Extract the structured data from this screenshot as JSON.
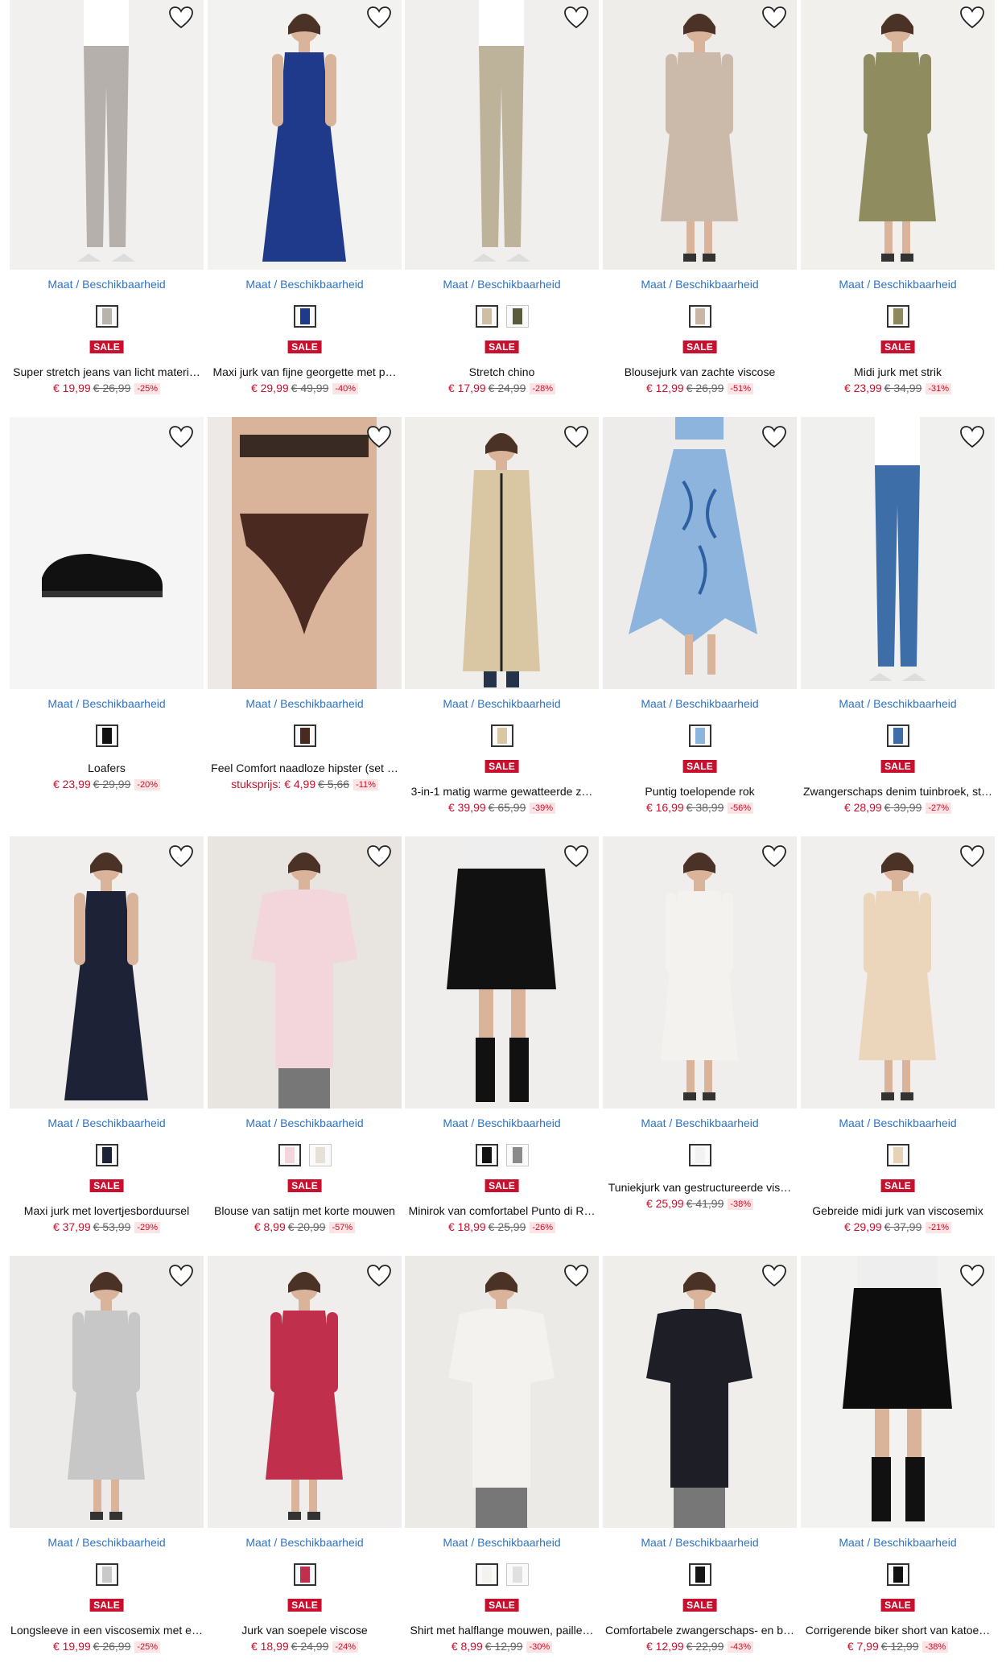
{
  "labels": {
    "maat": "Maat / Beschikbaarheid",
    "sale": "SALE"
  },
  "colors": {
    "accent": "#2f73c4",
    "sale": "#c8102e",
    "discount_bg": "#fde4e4"
  },
  "products": [
    {
      "name": "Super stretch jeans van licht materi…",
      "price": "€ 19,99",
      "old": "€ 26,99",
      "discount": "-25%",
      "sale": true,
      "swatches": [
        "#b9b3ad"
      ],
      "img": {
        "bg": "#f1f0ee",
        "type": "pants",
        "color": "#b6b0ac"
      }
    },
    {
      "name": "Maxi jurk van fijne georgette met p…",
      "price": "€ 29,99",
      "old": "€ 49,99",
      "discount": "-40%",
      "sale": true,
      "swatches": [
        "#1f3a8a"
      ],
      "img": {
        "bg": "#f2f2f0",
        "type": "dress-long",
        "color": "#1f3a8a"
      }
    },
    {
      "name": "Stretch chino",
      "price": "€ 17,99",
      "old": "€ 24,99",
      "discount": "-28%",
      "sale": true,
      "swatches": [
        "#cdbfa6",
        "#5a5a3c"
      ],
      "img": {
        "bg": "#f0efed",
        "type": "pants",
        "color": "#bdb29a"
      }
    },
    {
      "name": "Blousejurk van zachte viscose",
      "price": "€ 12,99",
      "old": "€ 26,99",
      "discount": "-51%",
      "sale": true,
      "swatches": [
        "#c8b5a6"
      ],
      "img": {
        "bg": "#eeedea",
        "type": "dress",
        "color": "#cbb9aa"
      }
    },
    {
      "name": "Midi jurk met strik",
      "price": "€ 23,99",
      "old": "€ 34,99",
      "discount": "-31%",
      "sale": true,
      "swatches": [
        "#8c8a5c"
      ],
      "img": {
        "bg": "#f1f0ed",
        "type": "dress",
        "color": "#8f8c5f"
      }
    },
    {
      "name": "Loafers",
      "price": "€ 23,99",
      "old": "€ 29,99",
      "discount": "-20%",
      "sale": false,
      "swatches": [
        "#111111"
      ],
      "img": {
        "bg": "#f5f5f5",
        "type": "shoe",
        "color": "#111111"
      }
    },
    {
      "name": "Feel Comfort naadloze hipster (set …",
      "price_label": "stuksprijs:",
      "price": "€ 4,99",
      "old": "€ 5,66",
      "discount": "-11%",
      "sale": false,
      "swatches": [
        "#4a2a20"
      ],
      "img": {
        "bg": "#ece9e6",
        "type": "brief",
        "color": "#4a2a20"
      }
    },
    {
      "name": "3-in-1 matig warme gewatteerde z…",
      "price": "€ 39,99",
      "old": "€ 65,99",
      "discount": "-39%",
      "sale": true,
      "swatches": [
        "#d9c7a4"
      ],
      "img": {
        "bg": "#efeeeb",
        "type": "coat",
        "color": "#d9c7a4"
      }
    },
    {
      "name": "Puntig toelopende rok",
      "price": "€ 16,99",
      "old": "€ 38,99",
      "discount": "-56%",
      "sale": true,
      "swatches": [
        "#8db4dc"
      ],
      "img": {
        "bg": "#eeecea",
        "type": "skirt",
        "color": "#8db4dc"
      }
    },
    {
      "name": "Zwangerschaps denim tuinbroek, st…",
      "price": "€ 28,99",
      "old": "€ 39,99",
      "discount": "-27%",
      "sale": true,
      "swatches": [
        "#3d6ea8"
      ],
      "img": {
        "bg": "#f0f0ee",
        "type": "pants",
        "color": "#3d6ea8"
      }
    },
    {
      "name": "Maxi jurk met lovertjesborduursel",
      "price": "€ 37,99",
      "old": "€ 53,99",
      "discount": "-29%",
      "sale": true,
      "swatches": [
        "#1d2236"
      ],
      "img": {
        "bg": "#f0efed",
        "type": "dress-long",
        "color": "#1d2236"
      }
    },
    {
      "name": "Blouse van satijn met korte mouwen",
      "price": "€ 8,99",
      "old": "€ 20,99",
      "discount": "-57%",
      "sale": true,
      "swatches": [
        "#f3d6dc",
        "#e5e0d8"
      ],
      "img": {
        "bg": "#e8e4e0",
        "type": "top",
        "color": "#f3d6dc"
      }
    },
    {
      "name": "Minirok van comfortabel Punto di R…",
      "price": "€ 18,99",
      "old": "€ 25,99",
      "discount": "-26%",
      "sale": true,
      "swatches": [
        "#111111",
        "#8a8a8a"
      ],
      "img": {
        "bg": "#efeeec",
        "type": "skirt-short",
        "color": "#111111"
      }
    },
    {
      "name": "Tuniekjurk van gestructureerde vis…",
      "price": "€ 25,99",
      "old": "€ 41,99",
      "discount": "-38%",
      "sale": false,
      "swatches": [
        "#f2f2f2"
      ],
      "img": {
        "bg": "#efeeec",
        "type": "dress",
        "color": "#f4f2ee"
      }
    },
    {
      "name": "Gebreide midi jurk van viscosemix",
      "price": "€ 29,99",
      "old": "€ 37,99",
      "discount": "-21%",
      "sale": true,
      "swatches": [
        "#e8d2b5"
      ],
      "img": {
        "bg": "#f0efed",
        "type": "dress",
        "color": "#ebd6bb"
      }
    },
    {
      "name": "Longsleeve in een viscosemix met e…",
      "price": "€ 19,99",
      "old": "€ 26,99",
      "discount": "-25%",
      "sale": true,
      "swatches": [
        "#c9c9c9"
      ],
      "img": {
        "bg": "#ecebe9",
        "type": "dress",
        "color": "#c7c7c7"
      }
    },
    {
      "name": "Jurk van soepele viscose",
      "price": "€ 18,99",
      "old": "€ 24,99",
      "discount": "-24%",
      "sale": true,
      "swatches": [
        "#c0304c"
      ],
      "img": {
        "bg": "#efeeec",
        "type": "dress",
        "color": "#c0304c"
      }
    },
    {
      "name": "Shirt met halflange mouwen, paille…",
      "price": "€ 8,99",
      "old": "€ 12,99",
      "discount": "-30%",
      "sale": true,
      "swatches": [
        "#f4f2ee",
        "#e0e0e0"
      ],
      "img": {
        "bg": "#eceae7",
        "type": "top",
        "color": "#f4f2ee"
      }
    },
    {
      "name": "Comfortabele zwangerschaps- en b…",
      "price": "€ 12,99",
      "old": "€ 22,99",
      "discount": "-43%",
      "sale": true,
      "swatches": [
        "#141414"
      ],
      "img": {
        "bg": "#efeeeb",
        "type": "top",
        "color": "#1e1f26"
      }
    },
    {
      "name": "Corrigerende biker short van katoe…",
      "price": "€ 7,99",
      "old": "€ 12,99",
      "discount": "-38%",
      "sale": true,
      "swatches": [
        "#111111"
      ],
      "img": {
        "bg": "#f2f2f1",
        "type": "skirt-short",
        "color": "#0d0d0d"
      }
    }
  ]
}
